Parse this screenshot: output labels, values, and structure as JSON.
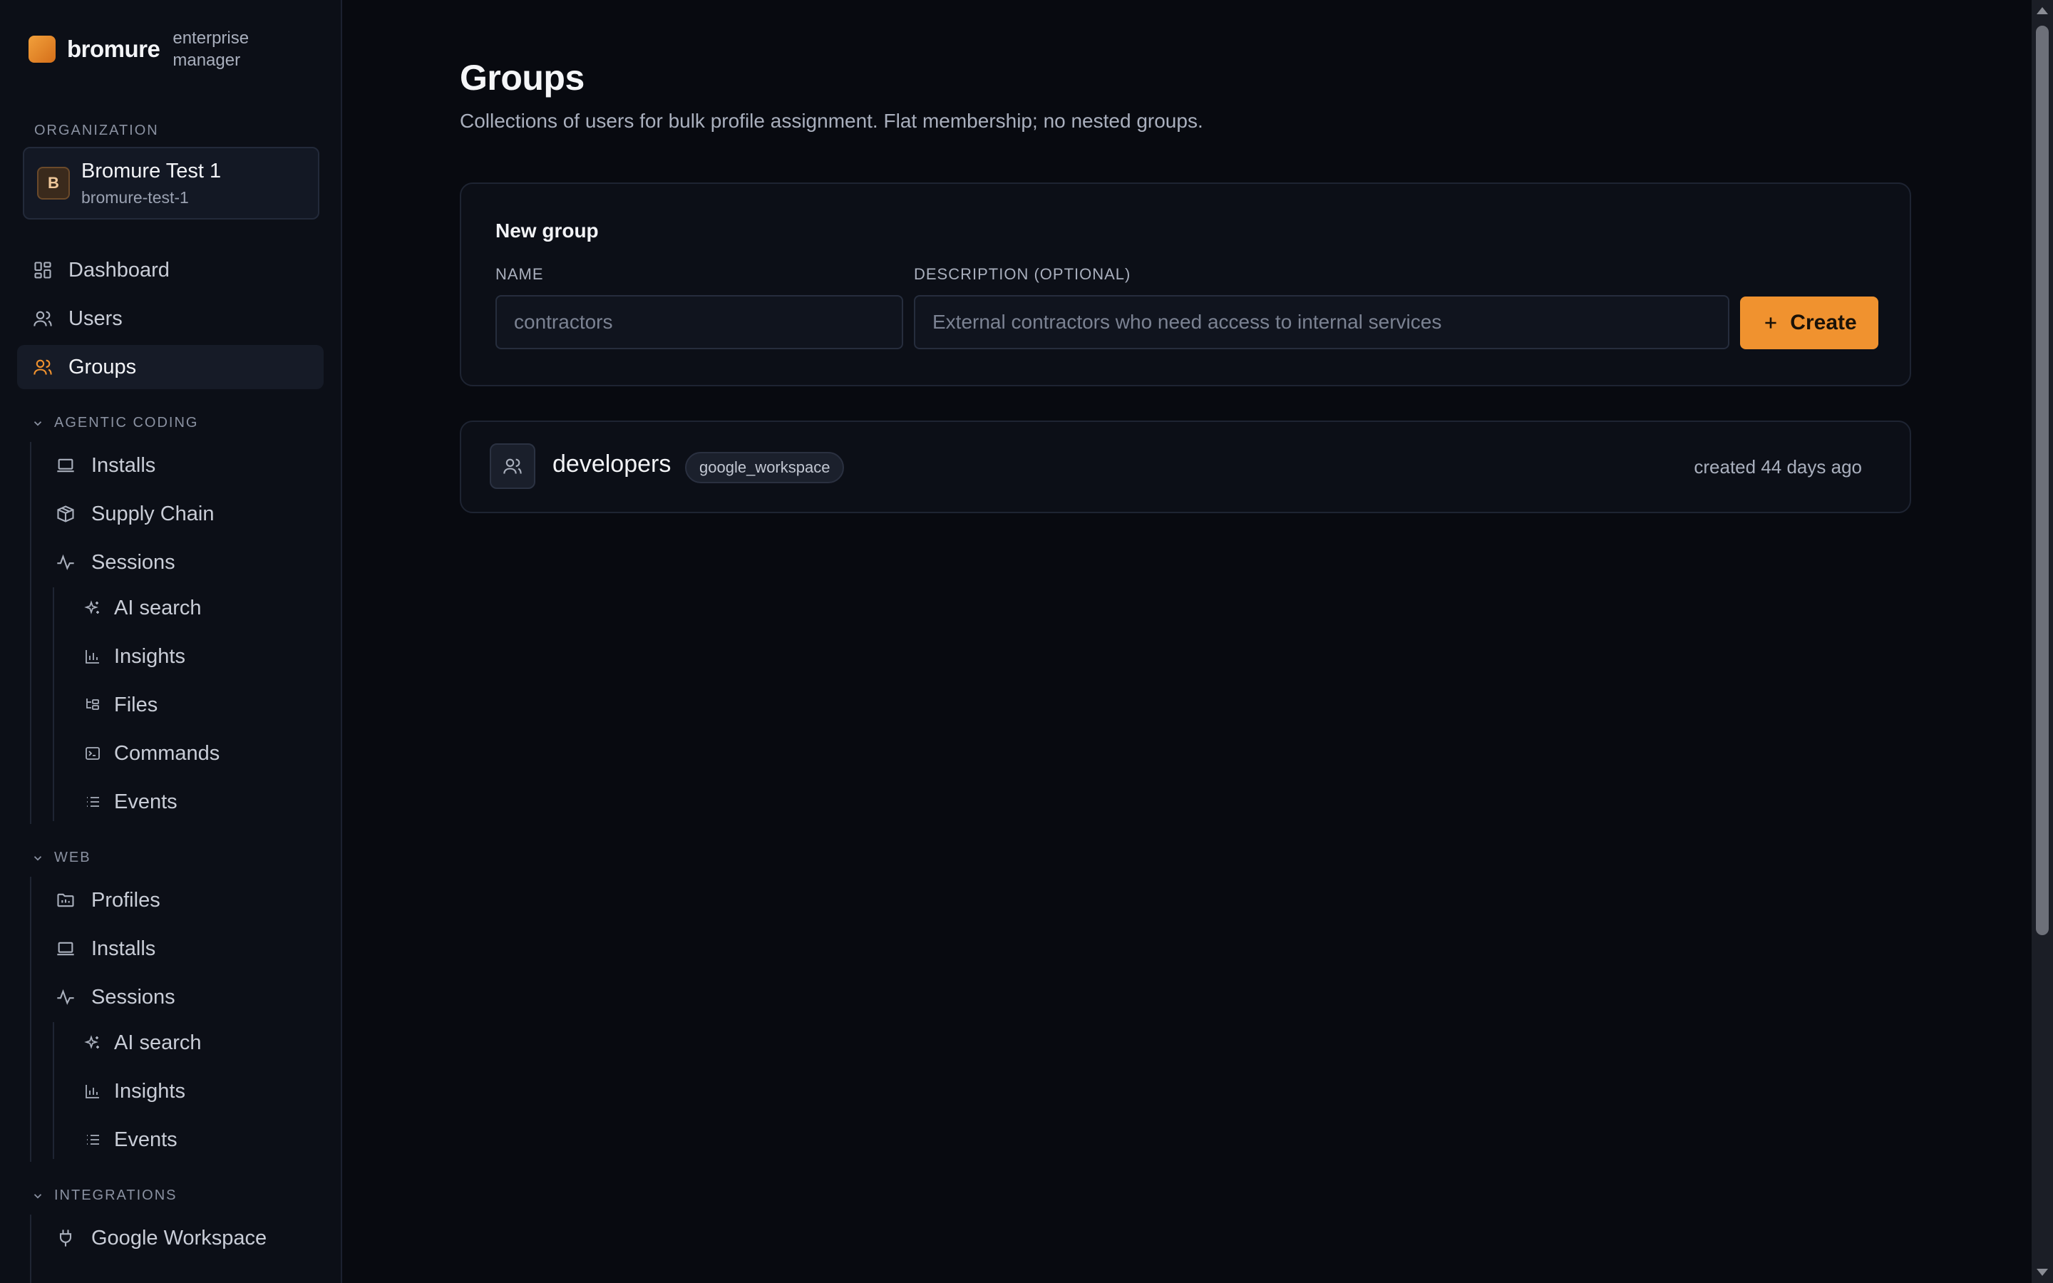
{
  "brand": {
    "name": "bromure",
    "sub": "enterprise manager",
    "accent": "#f0922f"
  },
  "organization": {
    "label": "ORGANIZATION",
    "avatar": "B",
    "name": "Bromure Test 1",
    "slug": "bromure-test-1"
  },
  "nav": {
    "dashboard": "Dashboard",
    "users": "Users",
    "groups": "Groups"
  },
  "agentic": {
    "label": "AGENTIC CODING",
    "installs": "Installs",
    "supply_chain": "Supply Chain",
    "sessions": "Sessions",
    "ai_search": "AI search",
    "insights": "Insights",
    "files": "Files",
    "commands": "Commands",
    "events": "Events"
  },
  "web": {
    "label": "WEB",
    "profiles": "Profiles",
    "installs": "Installs",
    "sessions": "Sessions",
    "ai_search": "AI search",
    "insights": "Insights",
    "events": "Events"
  },
  "integrations": {
    "label": "INTEGRATIONS",
    "google_workspace": "Google Workspace"
  },
  "page": {
    "title": "Groups",
    "subtitle": "Collections of users for bulk profile assignment. Flat membership; no nested groups."
  },
  "new_group": {
    "title": "New group",
    "name_label": "NAME",
    "name_placeholder": "contractors",
    "description_label": "DESCRIPTION (OPTIONAL)",
    "description_placeholder": "External contractors who need access to internal services",
    "create_label": "Create"
  },
  "groups": [
    {
      "name": "developers",
      "source": "google_workspace",
      "created": "created 44 days ago"
    }
  ]
}
